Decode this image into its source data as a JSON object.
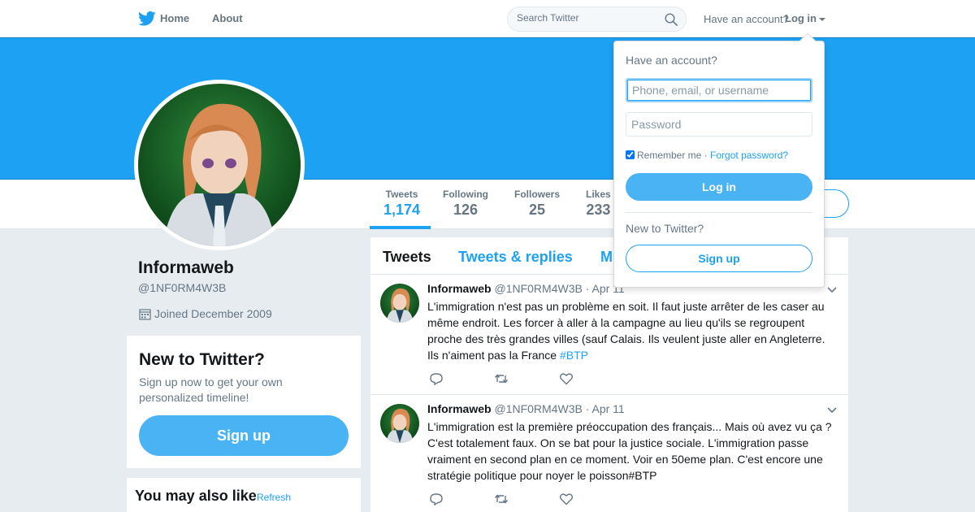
{
  "nav": {
    "home_label": "Home",
    "about_label": "About",
    "search_placeholder": "Search Twitter",
    "have_account_text": "Have an account?",
    "login_label": "Log in"
  },
  "profile": {
    "name": "Informaweb",
    "handle": "@1NF0RM4W3B",
    "joined": "Joined December 2009"
  },
  "stats": [
    {
      "label": "Tweets",
      "value": "1,174",
      "active": true
    },
    {
      "label": "Following",
      "value": "126"
    },
    {
      "label": "Followers",
      "value": "25"
    },
    {
      "label": "Likes",
      "value": "233"
    }
  ],
  "signup_card": {
    "title": "New to Twitter?",
    "text": "Sign up now to get your own personalized timeline!",
    "button": "Sign up"
  },
  "also_like": {
    "title": "You may also like",
    "separator": "·",
    "refresh": "Refresh"
  },
  "timeline_tabs": [
    "Tweets",
    "Tweets & replies",
    "M"
  ],
  "tweets": [
    {
      "fullname": "Informaweb",
      "username": "@1NF0RM4W3B",
      "time": "· Apr 11",
      "text": "L'immigration n'est pas un problème en soit. Il faut juste arrêter de les caser au même endroit. Les forcer à aller à la campagne au lieu qu'ils se regroupent proche des très grandes villes (sauf Calais. Ils veulent juste aller en Angleterre. Ils n'aiment pas la France ",
      "hashtag": "#BTP"
    },
    {
      "fullname": "Informaweb",
      "username": "@1NF0RM4W3B",
      "time": "· Apr 11",
      "text": "L'immigration est la première préoccupation des français... Mais où avez vu ça ? C'est totalement faux. On se bat pour la justice sociale. L'immigration passe vraiment en second plan en ce moment. Voir en 50eme plan. C'est encore une stratégie politique pour noyer le poisson#BTP",
      "hashtag": ""
    }
  ],
  "login_dropdown": {
    "title": "Have an account?",
    "username_placeholder": "Phone, email, or username",
    "password_placeholder": "Password",
    "remember_label": "Remember me",
    "separator": "·",
    "forgot_label": "Forgot password?",
    "login_button": "Log in",
    "new_text": "New to Twitter?",
    "signup_button": "Sign up"
  },
  "colors": {
    "brand": "#1da1f2",
    "button": "#4ab3f4",
    "background": "#e6ecf0"
  }
}
